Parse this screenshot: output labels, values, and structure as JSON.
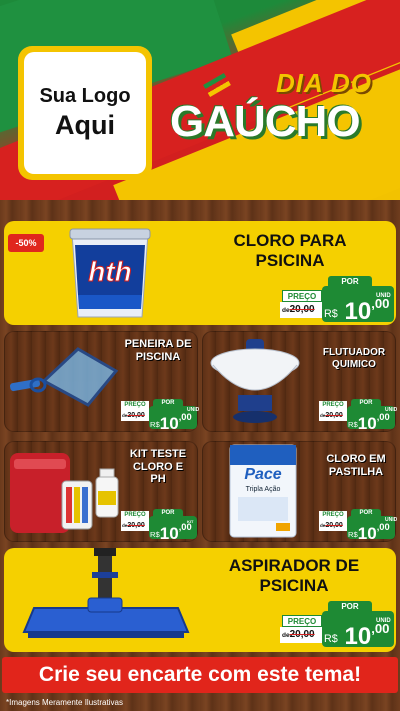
{
  "header": {
    "logo_line1": "Sua Logo",
    "logo_line2": "Aqui",
    "title_line1": "DIA DO",
    "title_line2": "GAÚCHO"
  },
  "products": [
    {
      "name": "CLORO PARA PSICINA",
      "badge": "-50%",
      "price_label": "PREÇO",
      "por_label": "POR",
      "old_prefix": "de",
      "old_price": "20,00",
      "currency": "R$",
      "price_int": "10",
      "price_cents": ",00",
      "unit": "UNID"
    },
    {
      "name": "PENEIRA DE PISCINA",
      "price_label": "PREÇO",
      "por_label": "POR",
      "old_prefix": "de",
      "old_price": "20,00",
      "currency": "R$",
      "price_int": "10",
      "price_cents": ",00",
      "unit": "UNID"
    },
    {
      "name": "FLUTUADOR QUIMICO",
      "price_label": "PREÇO",
      "por_label": "POR",
      "old_prefix": "de",
      "old_price": "20,00",
      "currency": "R$",
      "price_int": "10",
      "price_cents": ",00",
      "unit": "UNID"
    },
    {
      "name": "KIT TESTE CLORO E PH",
      "price_label": "PREÇO",
      "por_label": "POR",
      "old_prefix": "de",
      "old_price": "20,00",
      "currency": "R$",
      "price_int": "10",
      "price_cents": ",00",
      "unit": "KIT"
    },
    {
      "name": "CLORO EM PASTILHA",
      "price_label": "PREÇO",
      "por_label": "POR",
      "old_prefix": "de",
      "old_price": "20,00",
      "currency": "R$",
      "price_int": "10",
      "price_cents": ",00",
      "unit": "UNID"
    },
    {
      "name": "ASPIRADOR DE PSICINA",
      "price_label": "PREÇO",
      "por_label": "POR",
      "old_prefix": "de",
      "old_price": "20,00",
      "currency": "R$",
      "price_int": "10",
      "price_cents": ",00",
      "unit": "UNID"
    }
  ],
  "product_labels": {
    "hth_brand": "hth",
    "pace_brand": "Pace",
    "pace_sub": "Tripla Ação"
  },
  "cta": "Crie seu encarte com este tema!",
  "footnote": "*Imagens Meramente Ilustrativas",
  "colors": {
    "green": "#1e8a34",
    "red": "#e1251b",
    "yellow": "#f5d000"
  }
}
